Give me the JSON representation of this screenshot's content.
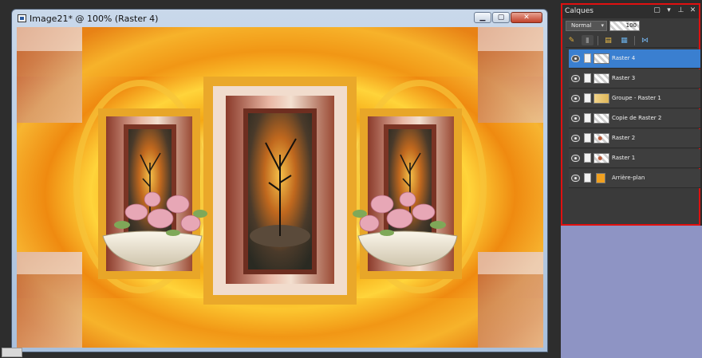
{
  "document": {
    "title": "Image21* @ 100% (Raster 4)",
    "buttons": {
      "minimize": "▁",
      "maximize": "▢",
      "close": "✕"
    }
  },
  "layers_panel": {
    "title": "Calques",
    "blend_mode": "Normal",
    "opacity": "100",
    "layers": [
      {
        "name": "Raster 4",
        "selected": true,
        "thumb": "transparent"
      },
      {
        "name": "Raster 3",
        "selected": false,
        "thumb": "transparent"
      },
      {
        "name": "Groupe - Raster 1",
        "selected": false,
        "thumb": "group"
      },
      {
        "name": "Copie de Raster 2",
        "selected": false,
        "thumb": "transparent"
      },
      {
        "name": "Raster 2",
        "selected": false,
        "thumb": "dots"
      },
      {
        "name": "Raster 1",
        "selected": false,
        "thumb": "dots"
      },
      {
        "name": "Arrière-plan",
        "selected": false,
        "thumb": "background"
      }
    ]
  },
  "colors": {
    "selection_blue": "#3a7fd0",
    "panel_highlight": "#e01010",
    "canvas_orange": "#f0a020"
  }
}
